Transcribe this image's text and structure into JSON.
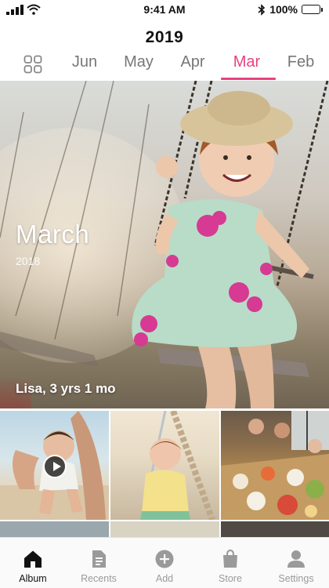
{
  "status_bar": {
    "time": "9:41 AM",
    "battery_percent": "100%",
    "signal_bars": 4,
    "battery_level": 1.0
  },
  "header": {
    "year": "2019",
    "months": [
      "Jun",
      "May",
      "Apr",
      "Mar",
      "Feb"
    ],
    "selected_month": "Mar",
    "accent_color": "#e8417f"
  },
  "hero": {
    "title": "March",
    "subtitle": "2018",
    "caption": "Lisa, 3 yrs 1 mo"
  },
  "thumbnails": [
    {
      "kind": "video"
    },
    {
      "kind": "photo"
    },
    {
      "kind": "photo"
    }
  ],
  "tab_bar": {
    "items": [
      {
        "label": "Album",
        "icon": "home-icon",
        "active": true
      },
      {
        "label": "Recents",
        "icon": "document-icon",
        "active": false
      },
      {
        "label": "Add",
        "icon": "plus-circle-icon",
        "active": false
      },
      {
        "label": "Store",
        "icon": "shopping-bag-icon",
        "active": false
      },
      {
        "label": "Settings",
        "icon": "person-icon",
        "active": false
      }
    ]
  }
}
